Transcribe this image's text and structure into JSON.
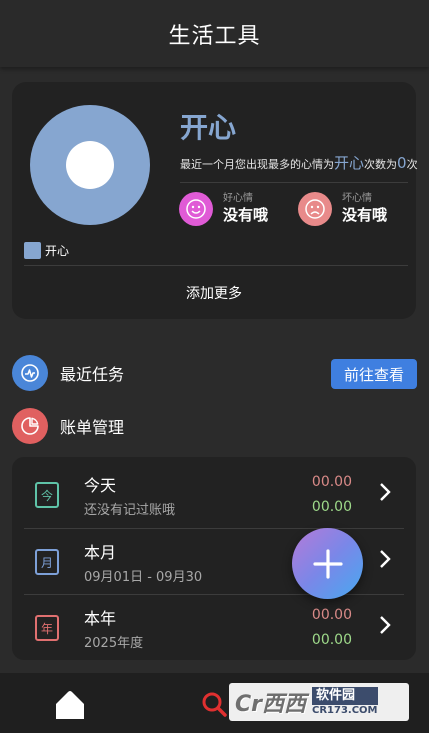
{
  "header": {
    "title": "生活工具"
  },
  "mood": {
    "chart_legend": "开心",
    "top_mood": "开心",
    "desc_prefix": "最近一个月您出现最多的心情为",
    "desc_mood": "开心",
    "desc_mid": "次数为",
    "desc_count": "0",
    "desc_suffix": "次",
    "good": {
      "label": "好心情",
      "value": "没有哦"
    },
    "bad": {
      "label": "坏心情",
      "value": "没有哦"
    },
    "add_more": "添加更多",
    "colors": {
      "chart": "#86a6d0",
      "good_face": "#e05bd6",
      "bad_face": "#e88a8a"
    }
  },
  "sections": {
    "recent_tasks": "最近任务",
    "go_view": "前往查看",
    "bill_management": "账单管理"
  },
  "bills": [
    {
      "icon_char": "今",
      "icon_color": "#5fc3a8",
      "name": "今天",
      "sub": "还没有记过账哦",
      "expense": "00.00",
      "income": "00.00"
    },
    {
      "icon_char": "月",
      "icon_color": "#7da0d8",
      "name": "本月",
      "sub": "09月01日 - 09月30",
      "expense": "",
      "income": ""
    },
    {
      "icon_char": "年",
      "icon_color": "#e07070",
      "name": "本年",
      "sub": "2025年度",
      "expense": "00.00",
      "income": "00.00"
    }
  ],
  "watermark": {
    "main": "Cr西西",
    "cn": "软件园",
    "en": "CR173.COM"
  }
}
